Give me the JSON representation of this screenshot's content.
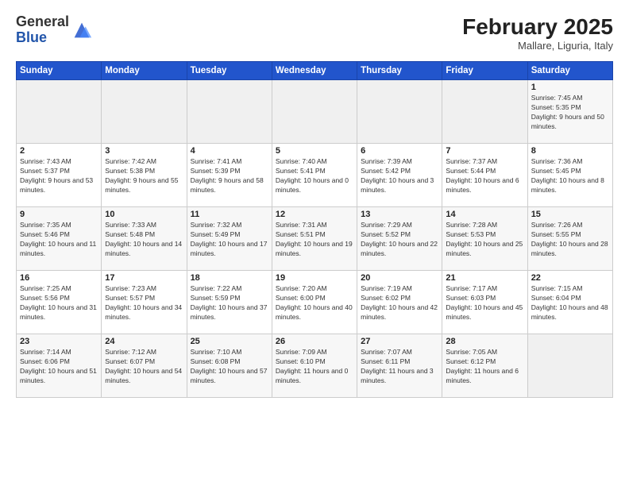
{
  "logo": {
    "general": "General",
    "blue": "Blue"
  },
  "header": {
    "title": "February 2025",
    "subtitle": "Mallare, Liguria, Italy"
  },
  "days_of_week": [
    "Sunday",
    "Monday",
    "Tuesday",
    "Wednesday",
    "Thursday",
    "Friday",
    "Saturday"
  ],
  "weeks": [
    [
      {
        "day": "",
        "info": ""
      },
      {
        "day": "",
        "info": ""
      },
      {
        "day": "",
        "info": ""
      },
      {
        "day": "",
        "info": ""
      },
      {
        "day": "",
        "info": ""
      },
      {
        "day": "",
        "info": ""
      },
      {
        "day": "1",
        "info": "Sunrise: 7:45 AM\nSunset: 5:35 PM\nDaylight: 9 hours and 50 minutes."
      }
    ],
    [
      {
        "day": "2",
        "info": "Sunrise: 7:43 AM\nSunset: 5:37 PM\nDaylight: 9 hours and 53 minutes."
      },
      {
        "day": "3",
        "info": "Sunrise: 7:42 AM\nSunset: 5:38 PM\nDaylight: 9 hours and 55 minutes."
      },
      {
        "day": "4",
        "info": "Sunrise: 7:41 AM\nSunset: 5:39 PM\nDaylight: 9 hours and 58 minutes."
      },
      {
        "day": "5",
        "info": "Sunrise: 7:40 AM\nSunset: 5:41 PM\nDaylight: 10 hours and 0 minutes."
      },
      {
        "day": "6",
        "info": "Sunrise: 7:39 AM\nSunset: 5:42 PM\nDaylight: 10 hours and 3 minutes."
      },
      {
        "day": "7",
        "info": "Sunrise: 7:37 AM\nSunset: 5:44 PM\nDaylight: 10 hours and 6 minutes."
      },
      {
        "day": "8",
        "info": "Sunrise: 7:36 AM\nSunset: 5:45 PM\nDaylight: 10 hours and 8 minutes."
      }
    ],
    [
      {
        "day": "9",
        "info": "Sunrise: 7:35 AM\nSunset: 5:46 PM\nDaylight: 10 hours and 11 minutes."
      },
      {
        "day": "10",
        "info": "Sunrise: 7:33 AM\nSunset: 5:48 PM\nDaylight: 10 hours and 14 minutes."
      },
      {
        "day": "11",
        "info": "Sunrise: 7:32 AM\nSunset: 5:49 PM\nDaylight: 10 hours and 17 minutes."
      },
      {
        "day": "12",
        "info": "Sunrise: 7:31 AM\nSunset: 5:51 PM\nDaylight: 10 hours and 19 minutes."
      },
      {
        "day": "13",
        "info": "Sunrise: 7:29 AM\nSunset: 5:52 PM\nDaylight: 10 hours and 22 minutes."
      },
      {
        "day": "14",
        "info": "Sunrise: 7:28 AM\nSunset: 5:53 PM\nDaylight: 10 hours and 25 minutes."
      },
      {
        "day": "15",
        "info": "Sunrise: 7:26 AM\nSunset: 5:55 PM\nDaylight: 10 hours and 28 minutes."
      }
    ],
    [
      {
        "day": "16",
        "info": "Sunrise: 7:25 AM\nSunset: 5:56 PM\nDaylight: 10 hours and 31 minutes."
      },
      {
        "day": "17",
        "info": "Sunrise: 7:23 AM\nSunset: 5:57 PM\nDaylight: 10 hours and 34 minutes."
      },
      {
        "day": "18",
        "info": "Sunrise: 7:22 AM\nSunset: 5:59 PM\nDaylight: 10 hours and 37 minutes."
      },
      {
        "day": "19",
        "info": "Sunrise: 7:20 AM\nSunset: 6:00 PM\nDaylight: 10 hours and 40 minutes."
      },
      {
        "day": "20",
        "info": "Sunrise: 7:19 AM\nSunset: 6:02 PM\nDaylight: 10 hours and 42 minutes."
      },
      {
        "day": "21",
        "info": "Sunrise: 7:17 AM\nSunset: 6:03 PM\nDaylight: 10 hours and 45 minutes."
      },
      {
        "day": "22",
        "info": "Sunrise: 7:15 AM\nSunset: 6:04 PM\nDaylight: 10 hours and 48 minutes."
      }
    ],
    [
      {
        "day": "23",
        "info": "Sunrise: 7:14 AM\nSunset: 6:06 PM\nDaylight: 10 hours and 51 minutes."
      },
      {
        "day": "24",
        "info": "Sunrise: 7:12 AM\nSunset: 6:07 PM\nDaylight: 10 hours and 54 minutes."
      },
      {
        "day": "25",
        "info": "Sunrise: 7:10 AM\nSunset: 6:08 PM\nDaylight: 10 hours and 57 minutes."
      },
      {
        "day": "26",
        "info": "Sunrise: 7:09 AM\nSunset: 6:10 PM\nDaylight: 11 hours and 0 minutes."
      },
      {
        "day": "27",
        "info": "Sunrise: 7:07 AM\nSunset: 6:11 PM\nDaylight: 11 hours and 3 minutes."
      },
      {
        "day": "28",
        "info": "Sunrise: 7:05 AM\nSunset: 6:12 PM\nDaylight: 11 hours and 6 minutes."
      },
      {
        "day": "",
        "info": ""
      }
    ]
  ]
}
